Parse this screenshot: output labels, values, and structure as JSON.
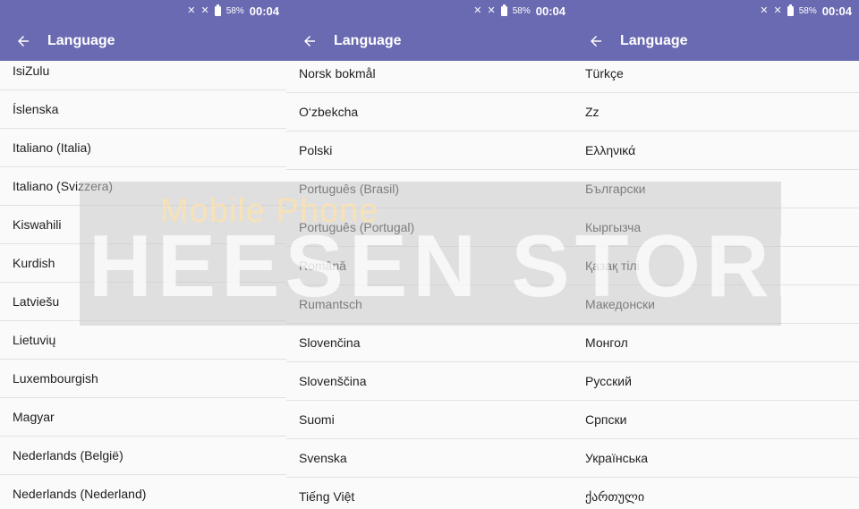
{
  "status_bar": {
    "battery": "58%",
    "time": "00:04"
  },
  "app_bar": {
    "title": "Language"
  },
  "panels": [
    {
      "items": [
        "IsiZulu",
        "Íslenska",
        "Italiano (Italia)",
        "Italiano (Svizzera)",
        "Kiswahili",
        "Kurdish",
        "Latviešu",
        "Lietuvių",
        "Luxembourgish",
        "Magyar",
        "Nederlands (België)",
        "Nederlands (Nederland)"
      ]
    },
    {
      "items": [
        "Norsk bokmål",
        "O‘zbekcha",
        "Polski",
        "Português (Brasil)",
        "Português (Portugal)",
        "Română",
        "Rumantsch",
        "Slovenčina",
        "Slovenščina",
        "Suomi",
        "Svenska",
        "Tiếng Việt"
      ]
    },
    {
      "items": [
        "Türkçe",
        "Zz",
        "Ελληνικά",
        "Български",
        "Кыргызча",
        "Қазақ тілі",
        "Македонски",
        "Монгол",
        "Русский",
        "Српски",
        "Українська",
        "ქართული"
      ]
    }
  ],
  "watermark": {
    "line1": "Mobile Phone",
    "line2": "HEESEN STORE"
  },
  "colors": {
    "toolbar": "#6a6ab2",
    "background": "#fafafa",
    "divider": "#e2e2e2"
  }
}
